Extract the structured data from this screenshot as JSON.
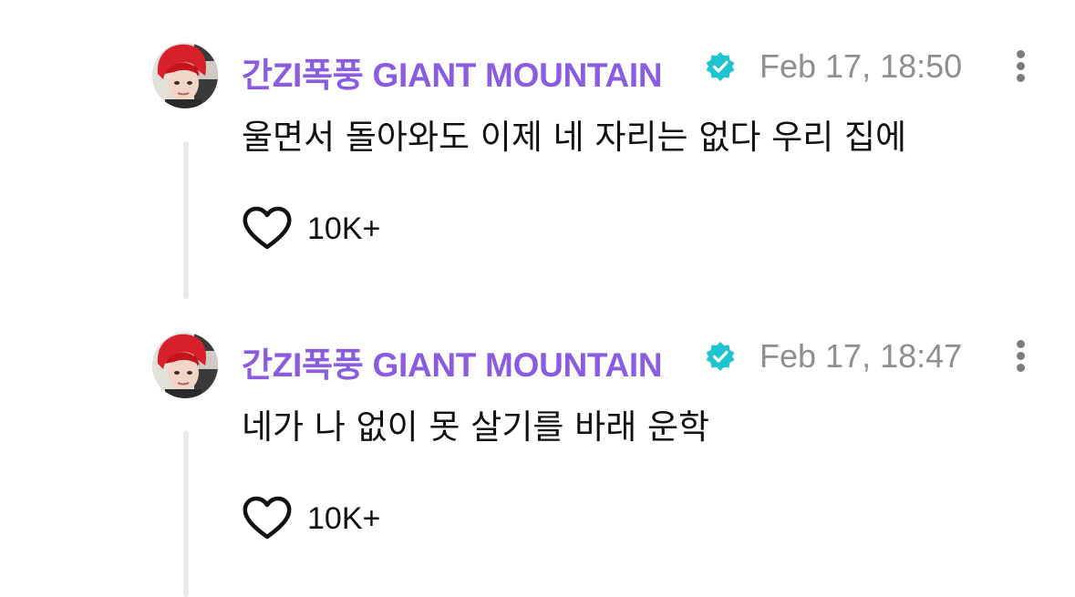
{
  "comments": [
    {
      "author": "간ZI폭풍 GIANT MOUNTAIN",
      "verified_icon": "verified-badge-icon",
      "timestamp": "Feb 17, 18:50",
      "text": "울면서 돌아와도 이제 네 자리는 없다 우리 집에",
      "like_icon": "heart-outline-icon",
      "like_count": "10K+"
    },
    {
      "author": "간ZI폭풍 GIANT MOUNTAIN",
      "verified_icon": "verified-badge-icon",
      "timestamp": "Feb 17, 18:47",
      "text": "네가 나 없이 못 살기를 바래 운학",
      "like_icon": "heart-outline-icon",
      "like_count": "10K+"
    }
  ],
  "colors": {
    "author_name": "#8a5ce0",
    "verified_badge": "#20c4cf",
    "timestamp": "#8e8e93",
    "text": "#111111",
    "thread_line": "#e9e9ee"
  }
}
